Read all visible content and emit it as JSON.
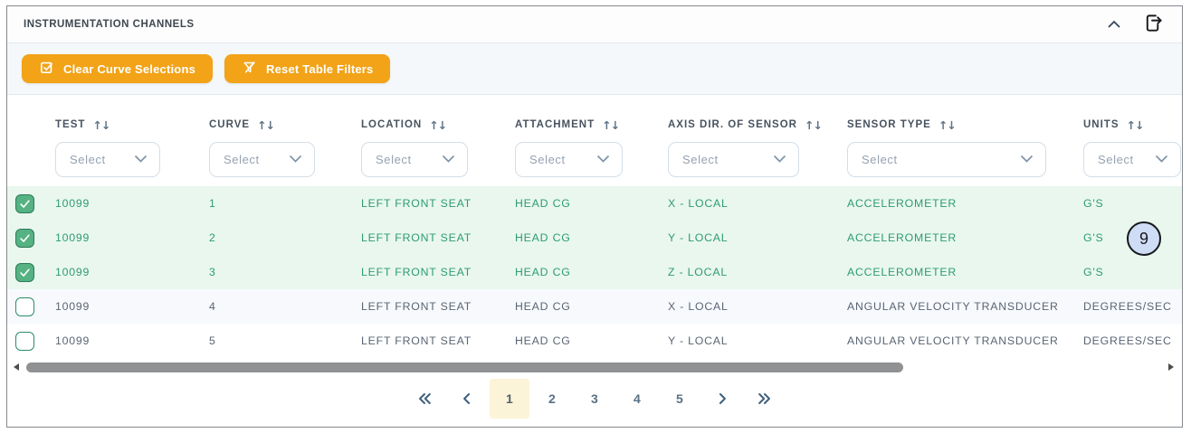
{
  "panel": {
    "title": "INSTRUMENTATION CHANNELS",
    "icons": {
      "collapse": "chevron-up-icon",
      "export": "file-export-icon"
    }
  },
  "toolbar": {
    "buttons": [
      {
        "label": "Clear Curve Selections",
        "icon": "checkbox-checked-icon"
      },
      {
        "label": "Reset Table Filters",
        "icon": "filter-off-icon"
      }
    ],
    "accent_color": "#F2A318"
  },
  "table": {
    "filter_placeholder": "Select",
    "sort_icon": "sort-arrows-icon",
    "sort_glyphs": "↑↓",
    "columns": [
      {
        "label": "TEST",
        "key": "test"
      },
      {
        "label": "CURVE",
        "key": "curve"
      },
      {
        "label": "LOCATION",
        "key": "location"
      },
      {
        "label": "ATTACHMENT",
        "key": "attachment"
      },
      {
        "label": "AXIS DIR. OF SENSOR",
        "key": "axis"
      },
      {
        "label": "SENSOR TYPE",
        "key": "sensor"
      },
      {
        "label": "UNITS",
        "key": "units"
      }
    ],
    "rows": [
      {
        "selected": true,
        "test": "10099",
        "curve": "1",
        "location": "LEFT FRONT SEAT",
        "attachment": "HEAD CG",
        "axis": "X - LOCAL",
        "sensor": "ACCELEROMETER",
        "units": "G'S"
      },
      {
        "selected": true,
        "test": "10099",
        "curve": "2",
        "location": "LEFT FRONT SEAT",
        "attachment": "HEAD CG",
        "axis": "Y - LOCAL",
        "sensor": "ACCELEROMETER",
        "units": "G'S"
      },
      {
        "selected": true,
        "test": "10099",
        "curve": "3",
        "location": "LEFT FRONT SEAT",
        "attachment": "HEAD CG",
        "axis": "Z - LOCAL",
        "sensor": "ACCELEROMETER",
        "units": "G'S"
      },
      {
        "selected": false,
        "test": "10099",
        "curve": "4",
        "location": "LEFT FRONT SEAT",
        "attachment": "HEAD CG",
        "axis": "X - LOCAL",
        "sensor": "ANGULAR VELOCITY TRANSDUCER",
        "units": "DEGREES/SEC"
      },
      {
        "selected": false,
        "test": "10099",
        "curve": "5",
        "location": "LEFT FRONT SEAT",
        "attachment": "HEAD CG",
        "axis": "Y - LOCAL",
        "sensor": "ANGULAR VELOCITY TRANSDUCER",
        "units": "DEGREES/SEC"
      }
    ],
    "colors": {
      "selected_row_bg": "#E9F7EE",
      "selected_text": "#2F9B74",
      "unselected_text": "#5A6573",
      "checkbox_green": "#56B282"
    }
  },
  "annotation": {
    "badge_label": "9"
  },
  "pagination": {
    "first_icon": "chevrons-left-icon",
    "prev_icon": "chevron-left-icon",
    "pages": [
      "1",
      "2",
      "3",
      "4",
      "5"
    ],
    "active_page": "1",
    "next_icon": "chevron-right-icon",
    "last_icon": "chevrons-right-icon"
  }
}
